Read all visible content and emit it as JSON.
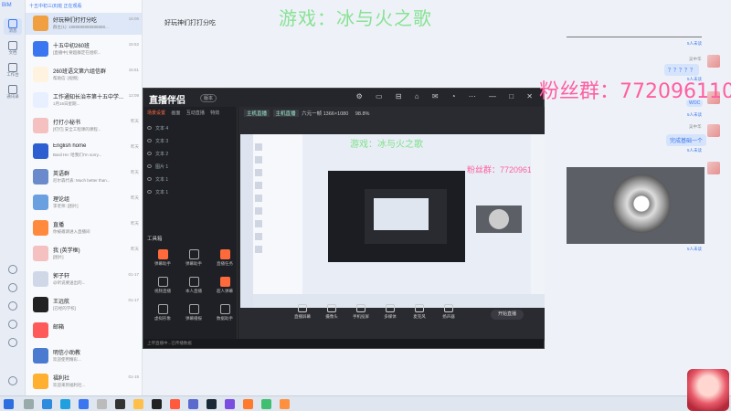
{
  "app": {
    "logo": "BIM"
  },
  "chathead": {
    "title": "好玩神们打打分吃"
  },
  "chatlist": {
    "header": "十五中初三(8)班 正在观看",
    "items": [
      {
        "name": "好玩神们打打分吃",
        "preview": "群主(1): 1888888888888888...",
        "time": "16:06",
        "color": "#f0a040",
        "selected": true
      },
      {
        "name": "十五中初260班",
        "preview": "[直播中] 要超群定在组织...",
        "time": "15:52",
        "color": "#3a76f0"
      },
      {
        "name": "260班语文第六组信群",
        "preview": "帮助信: [视频]",
        "time": "15:51",
        "color": "#fff3e0"
      },
      {
        "name": "工作通知长治市第十五中学...",
        "preview": "1月16日星期...",
        "time": "12:09",
        "color": "#e8f0ff"
      },
      {
        "name": "打打小秘书",
        "preview": "[打打] 安全工程课的课程...",
        "time": "昨天",
        "color": "#f4c0c0"
      },
      {
        "name": "English home",
        "preview": "Basil He: 哈我们I'm sorry...",
        "time": "昨天",
        "color": "#2d5fd0"
      },
      {
        "name": "英语群",
        "preview": "尼尔森代表: Much better than...",
        "time": "昨天",
        "color": "#6a8acb"
      },
      {
        "name": "理论组",
        "preview": "李老师: [图片]",
        "time": "昨天",
        "color": "#6aa0e0"
      },
      {
        "name": "直播",
        "preview": "你被邀请进入直播间",
        "time": "昨天",
        "color": "#ff8a3d"
      },
      {
        "name": "我 (英学框)",
        "preview": "[图片]",
        "time": "昨天",
        "color": "#f4c0c0"
      },
      {
        "name": "郭子轩",
        "preview": "@听说要送出的...",
        "time": "01-17",
        "color": "#d0d8e8"
      },
      {
        "name": "王远航",
        "preview": "[已经的学校]",
        "time": "01-17",
        "color": "#222"
      },
      {
        "name": "邮箱",
        "preview": "",
        "time": "",
        "color": "#ff5a5a"
      },
      {
        "name": "明信小助教",
        "preview": "欢迎使用精彩...",
        "time": "",
        "color": "#4a7bd0"
      },
      {
        "name": "福利社",
        "preview": "欢迎来到福利社...",
        "time": "01-15",
        "color": "#ffb030"
      }
    ]
  },
  "overlay": {
    "title": "游戏：冰与火之歌",
    "fans": "粉丝群：772096110"
  },
  "chat": {
    "unread_label": "5人未读",
    "sender": "吴中华",
    "bubbles": [
      "？？？？？",
      "666",
      "完成基础一个"
    ],
    "wow": "WOC"
  },
  "live": {
    "brand": "直播伴侣",
    "version": "版本",
    "tabs": [
      "场景设置",
      "画面",
      "互动直播",
      "特效"
    ],
    "layers": [
      "文本 4",
      "文本 3",
      "文本 2",
      "图片 1",
      "文本 1",
      "文本 1"
    ],
    "tools_title": "工具箱",
    "tools": [
      "弹幕助手",
      "弹幕助手",
      "直播任务",
      "视频直播",
      "本人直播",
      "超人弹幕",
      "虚拟形象",
      "弹幕播报",
      "数据助手"
    ],
    "scene_header": {
      "chip1": "主机直播",
      "chip2": "主机直播",
      "text": "六元一帧 1366×1080",
      "cpu": "98.8%"
    },
    "bottom": [
      "直播屏幕",
      "摄像头",
      "手机投屏",
      "多媒体",
      "麦克风",
      "扬声器"
    ],
    "start": "开始直播",
    "status": "上传直播中...已传播数据"
  },
  "window": {
    "controls": "— □ ✕"
  }
}
